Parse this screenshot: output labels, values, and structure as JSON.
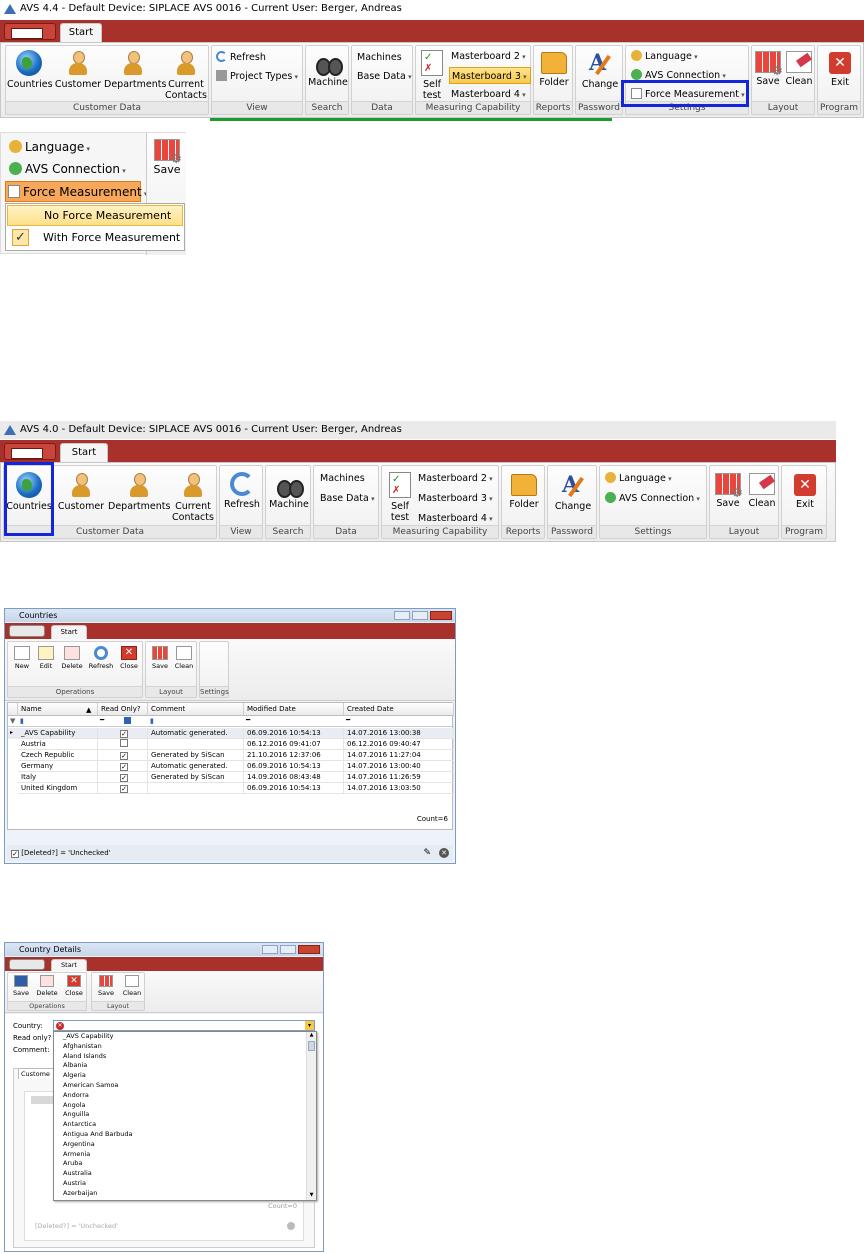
{
  "ribbon1": {
    "title": "AVS 4.4 - Default Device: SIPLACE AVS 0016 - Current User: Berger, Andreas",
    "tab": "Start",
    "customer_data": {
      "countries": "Countries",
      "customer": "Customer",
      "departments": "Departments",
      "current": "Current",
      "contacts": "Contacts",
      "label": "Customer Data"
    },
    "view": {
      "refresh": "Refresh",
      "project_types": "Project Types",
      "label": "View"
    },
    "search": {
      "machine": "Machine",
      "label": "Search"
    },
    "data": {
      "machines": "Machines",
      "base_data": "Base Data",
      "label": "Data"
    },
    "measuring": {
      "self": "Self",
      "test": "test",
      "mb2": "Masterboard 2",
      "mb3": "Masterboard 3",
      "mb4": "Masterboard 4",
      "label": "Measuring Capability"
    },
    "reports": {
      "folder": "Folder",
      "label": "Reports"
    },
    "password": {
      "change": "Change",
      "label": "Password"
    },
    "settings": {
      "language": "Language",
      "avs_connection": "AVS Connection",
      "force_measurement": "Force Measurement",
      "label": "Settings"
    },
    "layout": {
      "save": "Save",
      "clean": "Clean",
      "label": "Layout"
    },
    "program": {
      "exit": "Exit",
      "label": "Program"
    }
  },
  "dropdown": {
    "language": "Language",
    "avs_connection": "AVS Connection",
    "force_measurement": "Force Measurement",
    "save": "Save",
    "options": [
      "No Force Measurement",
      "With Force Measurement"
    ],
    "checked_index": 1
  },
  "ribbon2": {
    "title": "AVS 4.0 - Default Device: SIPLACE AVS 0016 - Current User: Berger, Andreas",
    "tab": "Start",
    "customer_data": {
      "countries": "Countries",
      "customer": "Customer",
      "departments": "Departments",
      "current": "Current",
      "contacts": "Contacts",
      "label": "Customer Data"
    },
    "view": {
      "refresh": "Refresh",
      "label": "View"
    },
    "search": {
      "machine": "Machine",
      "label": "Search"
    },
    "data": {
      "machines": "Machines",
      "base_data": "Base Data",
      "label": "Data"
    },
    "measuring": {
      "self": "Self",
      "test": "test",
      "mb2": "Masterboard 2",
      "mb3": "Masterboard 3",
      "mb4": "Masterboard 4",
      "label": "Measuring Capability"
    },
    "reports": {
      "folder": "Folder",
      "label": "Reports"
    },
    "password": {
      "change": "Change",
      "label": "Password"
    },
    "settings": {
      "language": "Language",
      "avs_connection": "AVS Connection",
      "label": "Settings"
    },
    "layout": {
      "save": "Save",
      "clean": "Clean",
      "label": "Layout"
    },
    "program": {
      "exit": "Exit",
      "label": "Program"
    }
  },
  "countries_window": {
    "title": "Countries",
    "tab": "Start",
    "buttons": {
      "new": "New",
      "edit": "Edit",
      "delete": "Delete",
      "refresh": "Refresh",
      "close": "Close",
      "save": "Save",
      "clean": "Clean"
    },
    "groups": {
      "operations": "Operations",
      "layout": "Layout",
      "settings": "Settings"
    },
    "columns": [
      "Name",
      "Read Only?",
      "Comment",
      "Modified Date",
      "Created Date"
    ],
    "rows": [
      {
        "name": "_AVS Capability",
        "read_only": true,
        "comment": "Automatic generated.",
        "modified": "06.09.2016 10:54:13",
        "created": "14.07.2016 13:00:38"
      },
      {
        "name": "Austria",
        "read_only": false,
        "comment": "",
        "modified": "06.12.2016 09:41:07",
        "created": "06.12.2016 09:40:47"
      },
      {
        "name": "Czech Republic",
        "read_only": true,
        "comment": "Generated by SiScan",
        "modified": "21.10.2016 12:37:06",
        "created": "14.07.2016 11:27:04"
      },
      {
        "name": "Germany",
        "read_only": true,
        "comment": "Automatic generated.",
        "modified": "06.09.2016 10:54:13",
        "created": "14.07.2016 13:00:40"
      },
      {
        "name": "Italy",
        "read_only": true,
        "comment": "Generated by SiScan",
        "modified": "14.09.2016 08:43:48",
        "created": "14.07.2016 11:26:59"
      },
      {
        "name": "United Kingdom",
        "read_only": true,
        "comment": "",
        "modified": "06.09.2016 10:54:13",
        "created": "14.07.2016 13:03:50"
      }
    ],
    "count": "Count=6",
    "filter": "[Deleted?] = 'Unchecked'"
  },
  "details_window": {
    "title": "Country Details",
    "tab": "Start",
    "buttons": {
      "save": "Save",
      "delete": "Delete",
      "close": "Close",
      "layout_save": "Save",
      "clean": "Clean"
    },
    "groups": {
      "operations": "Operations",
      "layout": "Layout"
    },
    "labels": {
      "country": "Country:",
      "read_only": "Read only?",
      "comment": "Comment:"
    },
    "country_list": [
      "_AVS Capability",
      "Afghanistan",
      "Aland Islands",
      "Albania",
      "Algeria",
      "American Samoa",
      "Andorra",
      "Angola",
      "Anguilla",
      "Antarctica",
      "Antigua And Barbuda",
      "Argentina",
      "Armenia",
      "Aruba",
      "Australia",
      "Austria",
      "Azerbaijan"
    ],
    "sub_tab": "Custome",
    "count": "Count=0",
    "filter": "[Deleted?] = 'Unchecked'"
  }
}
